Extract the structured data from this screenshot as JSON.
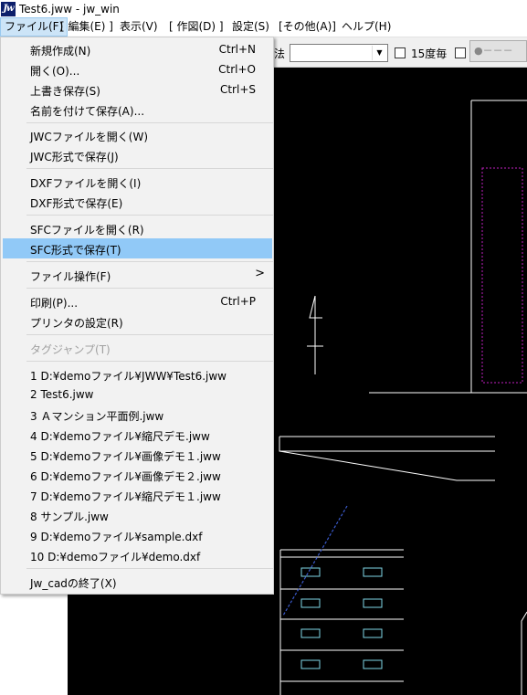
{
  "window": {
    "title": "Test6.jww - jw_win",
    "icon": "jw-app-icon"
  },
  "menubar": {
    "items": [
      {
        "label": "ファイル(F)",
        "active": true
      },
      {
        "label": "[ 編集(E) ]"
      },
      {
        "label": "表示(V)"
      },
      {
        "label": "[ 作図(D) ]"
      },
      {
        "label": "設定(S)"
      },
      {
        "label": "[その他(A)]"
      },
      {
        "label": "ヘルプ(H)"
      }
    ]
  },
  "toolbar": {
    "fragment": "法",
    "combo_value": "",
    "check_15deg_label": "15度毎",
    "check_15deg_checked": false,
    "check2_checked": false,
    "line_button_label": "●－－－"
  },
  "file_menu": {
    "items": [
      {
        "label": "新規作成(N)",
        "shortcut": "Ctrl+N"
      },
      {
        "label": "開く(O)...",
        "shortcut": "Ctrl+O"
      },
      {
        "label": "上書き保存(S)",
        "shortcut": "Ctrl+S"
      },
      {
        "label": "名前を付けて保存(A)...",
        "shortcut": ""
      },
      {
        "label": "JWCファイルを開く(W)",
        "shortcut": ""
      },
      {
        "label": "JWC形式で保存(J)",
        "shortcut": ""
      },
      {
        "label": "DXFファイルを開く(I)",
        "shortcut": ""
      },
      {
        "label": "DXF形式で保存(E)",
        "shortcut": ""
      },
      {
        "label": "SFCファイルを開く(R)",
        "shortcut": ""
      },
      {
        "label": "SFC形式で保存(T)",
        "shortcut": "",
        "highlighted": true
      },
      {
        "label": "ファイル操作(F)",
        "shortcut": "",
        "submenu": true
      },
      {
        "label": "印刷(P)...",
        "shortcut": "Ctrl+P"
      },
      {
        "label": "プリンタの設定(R)",
        "shortcut": ""
      },
      {
        "label": "タグジャンプ(T)",
        "shortcut": "",
        "disabled": true
      },
      {
        "label": "1 D:¥demoファイル¥JWW¥Test6.jww",
        "shortcut": ""
      },
      {
        "label": "2 Test6.jww",
        "shortcut": ""
      },
      {
        "label": "3 Ａマンション平面例.jww",
        "shortcut": ""
      },
      {
        "label": "4 D:¥demoファイル¥縮尺デモ.jww",
        "shortcut": ""
      },
      {
        "label": "5 D:¥demoファイル¥画像デモ１.jww",
        "shortcut": ""
      },
      {
        "label": "6 D:¥demoファイル¥画像デモ２.jww",
        "shortcut": ""
      },
      {
        "label": "7 D:¥demoファイル¥縮尺デモ１.jww",
        "shortcut": ""
      },
      {
        "label": "8 サンプル.jww",
        "shortcut": ""
      },
      {
        "label": "9 D:¥demoファイル¥sample.dxf",
        "shortcut": ""
      },
      {
        "label": "10 D:¥demoファイル¥demo.dxf",
        "shortcut": ""
      },
      {
        "label": "Jw_cadの終了(X)",
        "shortcut": ""
      }
    ],
    "submenu_arrow": ">"
  },
  "colors": {
    "menu_highlight": "#91c9f7",
    "menubar_active": "#cce4f7",
    "canvas_bg": "#000000",
    "drawing_line": "#ffffff",
    "drawing_magenta": "#c020c0",
    "drawing_cyan": "#7fd8e8",
    "drawing_blue": "#3a5acc"
  }
}
